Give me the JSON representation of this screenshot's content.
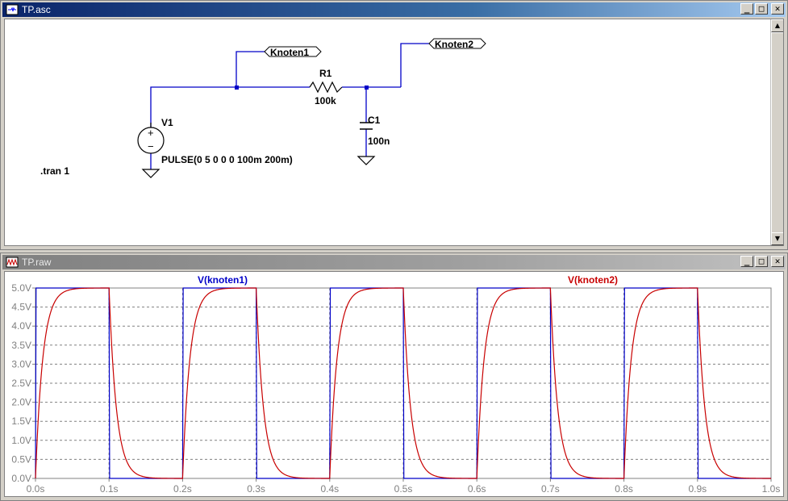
{
  "schematic_window": {
    "title": "TP.asc",
    "buttons": {
      "minimize": "_",
      "maximize": "□",
      "close": "✕"
    },
    "components": {
      "v1": {
        "name": "V1",
        "value": "PULSE(0 5 0 0 0 100m 200m)"
      },
      "r1": {
        "name": "R1",
        "value": "100k"
      },
      "c1": {
        "name": "C1",
        "value": "100n"
      }
    },
    "net_labels": [
      "Knoten1",
      "Knoten2"
    ],
    "directive": ".tran 1"
  },
  "plot_window": {
    "title": "TP.raw",
    "buttons": {
      "minimize": "_",
      "maximize": "□",
      "close": "✕"
    }
  },
  "colors": {
    "wire": "#0000c8",
    "knoten1": "#0000c8",
    "knoten2": "#c80000",
    "grid": "#808080",
    "tick_text": "#808080"
  },
  "chart_data": {
    "type": "line",
    "x_ticks": [
      "0.0s",
      "0.1s",
      "0.2s",
      "0.3s",
      "0.4s",
      "0.5s",
      "0.6s",
      "0.7s",
      "0.8s",
      "0.9s",
      "1.0s"
    ],
    "y_ticks": [
      "0.0V",
      "0.5V",
      "1.0V",
      "1.5V",
      "2.0V",
      "2.5V",
      "3.0V",
      "3.5V",
      "4.0V",
      "4.5V",
      "5.0V"
    ],
    "xlim": [
      0,
      1
    ],
    "ylim": [
      0,
      5
    ],
    "grid": true,
    "series": [
      {
        "name": "V(knoten1)",
        "color": "#0000c8",
        "kind": "pulse",
        "v_high": 5,
        "width": 0.1,
        "period": 0.2
      },
      {
        "name": "V(knoten2)",
        "color": "#c80000",
        "kind": "rc",
        "v_high": 5,
        "tau": 0.01,
        "period": 0.2
      }
    ]
  }
}
